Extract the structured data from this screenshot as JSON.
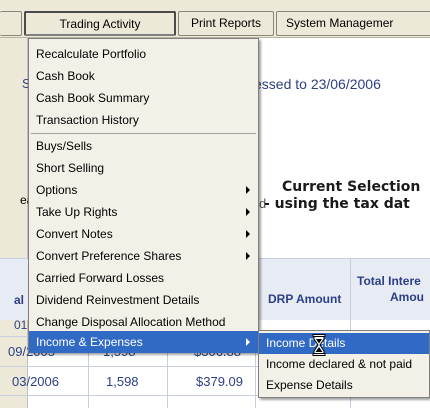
{
  "menubar": {
    "items": [
      "Trading Activity",
      "Print Reports",
      "System Managemer"
    ]
  },
  "background": {
    "left_fragments": [
      "Su",
      "eal",
      "al",
      "01",
      "09/2005",
      "03/2006"
    ],
    "processed_text": "essed to 23/06/2006",
    "current_selection_line1": "Current Selection",
    "current_selection_line2": "- using the tax dat",
    "left_side_partial": "d",
    "columns": {
      "drp_amount": "DRP Amount",
      "total_interest_line1": "Total Intere",
      "total_interest_line2": "Amou"
    },
    "rows": [
      {
        "date": "09/2005",
        "units": "1,598",
        "drp": "$306.88"
      },
      {
        "date": "03/2006",
        "units": "1,598",
        "drp": "$379.09"
      }
    ]
  },
  "dropdown": {
    "items": [
      {
        "label": "Recalculate Portfolio",
        "submenu": false
      },
      {
        "label": "Cash Book",
        "submenu": false
      },
      {
        "label": "Cash Book Summary",
        "submenu": false
      },
      {
        "label": "Transaction History",
        "submenu": false
      },
      {
        "label": "Buys/Sells",
        "submenu": false
      },
      {
        "label": "Short Selling",
        "submenu": false
      },
      {
        "label": "Options",
        "submenu": true
      },
      {
        "label": "Take Up Rights",
        "submenu": true
      },
      {
        "label": "Convert Notes",
        "submenu": true
      },
      {
        "label": "Convert Preference Shares",
        "submenu": true
      },
      {
        "label": "Carried Forward Losses",
        "submenu": false
      },
      {
        "label": "Dividend Reinvestment Details",
        "submenu": false
      },
      {
        "label": "Change Disposal Allocation Method",
        "submenu": false
      },
      {
        "label": "Income & Expenses",
        "submenu": true,
        "highlighted": true
      }
    ]
  },
  "submenu": {
    "items": [
      {
        "label": "Income Details",
        "highlighted": true
      },
      {
        "label": "Income declared & not paid"
      },
      {
        "label": "Expense Details"
      }
    ]
  },
  "colors": {
    "highlight": "#316ac5",
    "menu_bg": "#f2f0e7",
    "bar_bg": "#ece9d8",
    "grid_text": "#2c3f86"
  }
}
